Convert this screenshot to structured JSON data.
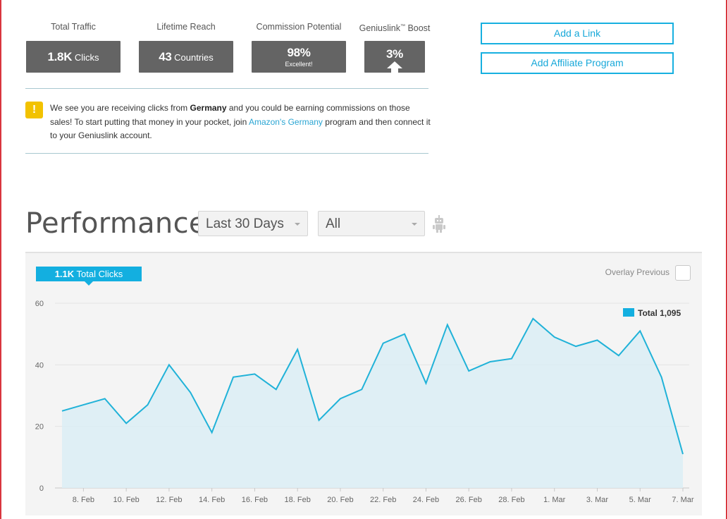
{
  "stats": {
    "traffic": {
      "label": "Total Traffic",
      "value": "1.8K",
      "unit": "Clicks"
    },
    "reach": {
      "label": "Lifetime Reach",
      "value": "43",
      "unit": "Countries"
    },
    "commission": {
      "label": "Commission Potential",
      "value": "98%",
      "sub": "Excellent!"
    },
    "boost": {
      "label_main": "Geniuslink",
      "label_tm": "™",
      "label_rest": " Boost",
      "value": "3%"
    }
  },
  "buttons": {
    "add_link": "Add a Link",
    "add_program": "Add Affiliate Program"
  },
  "alert": {
    "icon": "!",
    "t1": "We see you are receiving clicks from ",
    "country": "Germany",
    "t2": " and you could be earning commissions on those sales! To start putting that money in your pocket, join ",
    "link": "Amazon's Germany",
    "t3": " program and then connect it to your Geniuslink account."
  },
  "performance": {
    "title": "Performance",
    "range": "Last 30 Days",
    "filter": "All"
  },
  "chart_header": {
    "badge_value": "1.1K",
    "badge_label": " Total Clicks",
    "overlay_label": "Overlay Previous"
  },
  "colors": {
    "accent": "#13afe0",
    "stat_box": "#646464",
    "alert": "#f2c200",
    "line": "#20b2d8",
    "area": "#dbedf4"
  },
  "chart_data": {
    "type": "area",
    "x": [
      "7. Feb",
      "8. Feb",
      "9. Feb",
      "10. Feb",
      "11. Feb",
      "12. Feb",
      "13. Feb",
      "14. Feb",
      "15. Feb",
      "16. Feb",
      "17. Feb",
      "18. Feb",
      "19. Feb",
      "20. Feb",
      "21. Feb",
      "22. Feb",
      "23. Feb",
      "24. Feb",
      "25. Feb",
      "26. Feb",
      "27. Feb",
      "28. Feb",
      "29. Feb",
      "1. Mar",
      "2. Mar",
      "3. Mar",
      "4. Mar",
      "5. Mar",
      "6. Mar",
      "7. Mar"
    ],
    "series": [
      {
        "name": "Total",
        "total_label": "1,095",
        "values": [
          25,
          27,
          29,
          21,
          27,
          40,
          31,
          18,
          36,
          37,
          32,
          45,
          22,
          29,
          32,
          47,
          50,
          34,
          53,
          38,
          41,
          42,
          55,
          49,
          46,
          48,
          43,
          51,
          36,
          11
        ]
      }
    ],
    "xticks": [
      "8. Feb",
      "10. Feb",
      "12. Feb",
      "14. Feb",
      "16. Feb",
      "18. Feb",
      "20. Feb",
      "22. Feb",
      "24. Feb",
      "26. Feb",
      "28. Feb",
      "1. Mar",
      "3. Mar",
      "5. Mar",
      "7. Mar"
    ],
    "yticks": [
      0,
      20,
      40,
      60
    ],
    "ylim": [
      0,
      60
    ],
    "grid": true,
    "legend": "top-right"
  }
}
